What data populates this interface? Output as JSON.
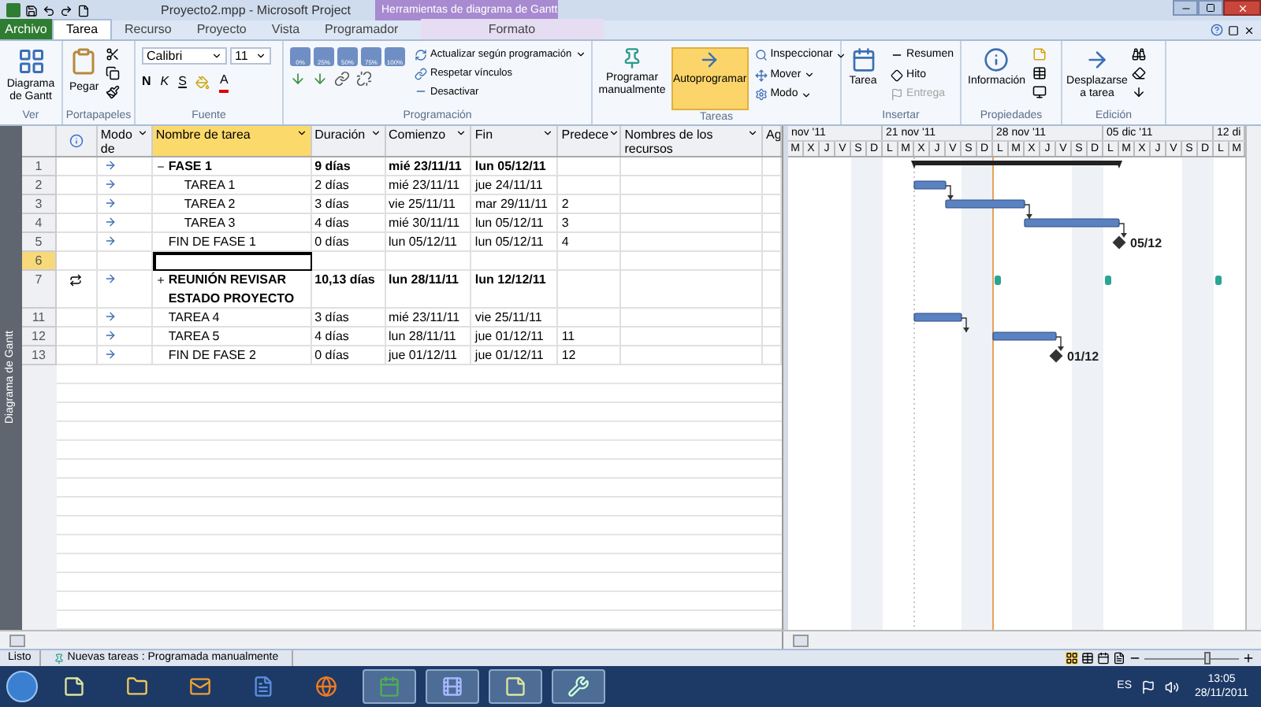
{
  "title_bar": {
    "title": "Proyecto2.mpp - Microsoft Project",
    "contextual_tab": "Herramientas de diagrama de Gantt"
  },
  "tabs": [
    {
      "label": "Archivo",
      "kind": "file",
      "selected": false
    },
    {
      "label": "Tarea",
      "kind": "tab",
      "selected": true
    },
    {
      "label": "Recurso",
      "kind": "tab",
      "selected": false
    },
    {
      "label": "Proyecto",
      "kind": "tab",
      "selected": false
    },
    {
      "label": "Vista",
      "kind": "tab",
      "selected": false
    },
    {
      "label": "Programador",
      "kind": "tab",
      "selected": false
    },
    {
      "label": "Formato",
      "kind": "contextual",
      "selected": false
    }
  ],
  "ribbon": {
    "ver": {
      "label": "Ver",
      "button": "Diagrama de Gantt"
    },
    "portapapeles": {
      "label": "Portapapeles",
      "paste": "Pegar"
    },
    "fuente": {
      "label": "Fuente",
      "font": "Calibri",
      "size": "11",
      "bold": "N",
      "italic": "K",
      "underline": "S",
      "color_letter": "A"
    },
    "programacion": {
      "label": "Programación",
      "percent_buttons": [
        "0%",
        "25%",
        "50%",
        "75%",
        "100%"
      ],
      "commands": [
        "Actualizar según programación",
        "Respetar vínculos",
        "Desactivar"
      ]
    },
    "tareas": {
      "label": "Tareas",
      "buttons": [
        {
          "label": "Programar manualmente",
          "selected": false
        },
        {
          "label": "Autoprogramar",
          "selected": true
        }
      ],
      "commands": [
        "Inspeccionar",
        "Mover",
        "Modo"
      ]
    },
    "insertar": {
      "label": "Insertar",
      "task": "Tarea",
      "commands": [
        {
          "label": "Resumen",
          "disabled": false
        },
        {
          "label": "Hito",
          "disabled": false
        },
        {
          "label": "Entrega",
          "disabled": true
        }
      ]
    },
    "propiedades": {
      "label": "Propiedades",
      "info": "Información"
    },
    "edicion": {
      "label": "Edición",
      "scroll": "Desplazarse a tarea"
    }
  },
  "side_label": "Diagrama de Gantt",
  "table": {
    "columns": [
      {
        "label": "Modo de",
        "selected": false
      },
      {
        "label": "Nombre de tarea",
        "selected": true
      },
      {
        "label": "Duración",
        "selected": false
      },
      {
        "label": "Comienzo",
        "selected": false
      },
      {
        "label": "Fin",
        "selected": false
      },
      {
        "label": "Predece",
        "selected": false
      },
      {
        "label": "Nombres de los recursos",
        "selected": false
      },
      {
        "label": "Ag",
        "selected": false
      }
    ],
    "rows": [
      {
        "id": "1",
        "kind": "summary",
        "name": "FASE 1",
        "expanded": true,
        "duration": "9 días",
        "start": "mié 23/11/11",
        "finish": "lun 05/12/11",
        "selected": false,
        "children": [
          {
            "id": "2",
            "kind": "task",
            "name": "TAREA 1",
            "duration": "2 días",
            "start": "mié 23/11/11",
            "finish": "jue 24/11/11",
            "selected": false
          },
          {
            "id": "3",
            "kind": "task",
            "name": "TAREA 2",
            "duration": "3 días",
            "start": "vie 25/11/11",
            "finish": "mar 29/11/11",
            "predecessors": "2",
            "selected": false
          },
          {
            "id": "4",
            "kind": "task",
            "name": "TAREA 3",
            "duration": "4 días",
            "start": "mié 30/11/11",
            "finish": "lun 05/12/11",
            "predecessors": "3",
            "selected": false
          }
        ]
      },
      {
        "id": "5",
        "kind": "milestone",
        "name": "FIN DE FASE 1",
        "duration": "0 días",
        "start": "lun 05/12/11",
        "finish": "lun 05/12/11",
        "predecessors": "4",
        "bar_label": "05/12",
        "selected": false
      },
      {
        "id": "6",
        "kind": "empty",
        "selected": true
      },
      {
        "id": "7",
        "kind": "recurring",
        "name": "REUNIÓN REVISAR ESTADO PROYECTO",
        "expanded": false,
        "duration": "10,13 días",
        "start": "lun 28/11/11",
        "finish": "lun 12/12/11",
        "selected": false
      },
      {
        "id": "11",
        "kind": "task",
        "name": "TAREA 4",
        "duration": "3 días",
        "start": "mié 23/11/11",
        "finish": "vie 25/11/11",
        "selected": false
      },
      {
        "id": "12",
        "kind": "task",
        "name": "TAREA 5",
        "duration": "4 días",
        "start": "lun 28/11/11",
        "finish": "jue 01/12/11",
        "predecessors": "11",
        "selected": false
      },
      {
        "id": "13",
        "kind": "milestone",
        "name": "FIN DE FASE 2",
        "duration": "0 días",
        "start": "jue 01/12/11",
        "finish": "jue 01/12/11",
        "predecessors": "12",
        "bar_label": "01/12",
        "selected": false
      }
    ]
  },
  "timeline": {
    "weeks": [
      "nov '11",
      "21 nov '11",
      "28 nov '11",
      "05 dic '11",
      "12 di"
    ],
    "days": [
      "M",
      "X",
      "J",
      "V",
      "S",
      "D",
      "L",
      "M",
      "X",
      "J",
      "V",
      "S",
      "D",
      "L",
      "M",
      "X",
      "J",
      "V",
      "S",
      "D",
      "L",
      "M",
      "X",
      "J",
      "V",
      "S",
      "D",
      "L",
      "M"
    ]
  },
  "status_bar": {
    "ready": "Listo",
    "new_tasks": "Nuevas tareas : Programada manualmente",
    "zoom": {
      "level": 0.66
    }
  },
  "taskbar": {
    "apps": [
      {
        "kind": "notes",
        "running": false
      },
      {
        "kind": "folder",
        "running": false
      },
      {
        "kind": "mail",
        "running": false
      },
      {
        "kind": "word",
        "running": false
      },
      {
        "kind": "browser",
        "running": false
      },
      {
        "kind": "project",
        "running": true
      },
      {
        "kind": "media",
        "running": true
      },
      {
        "kind": "notes",
        "running": true
      },
      {
        "kind": "tool",
        "running": true
      }
    ],
    "language": "ES",
    "time": "13:05",
    "date": "28/11/2011"
  }
}
